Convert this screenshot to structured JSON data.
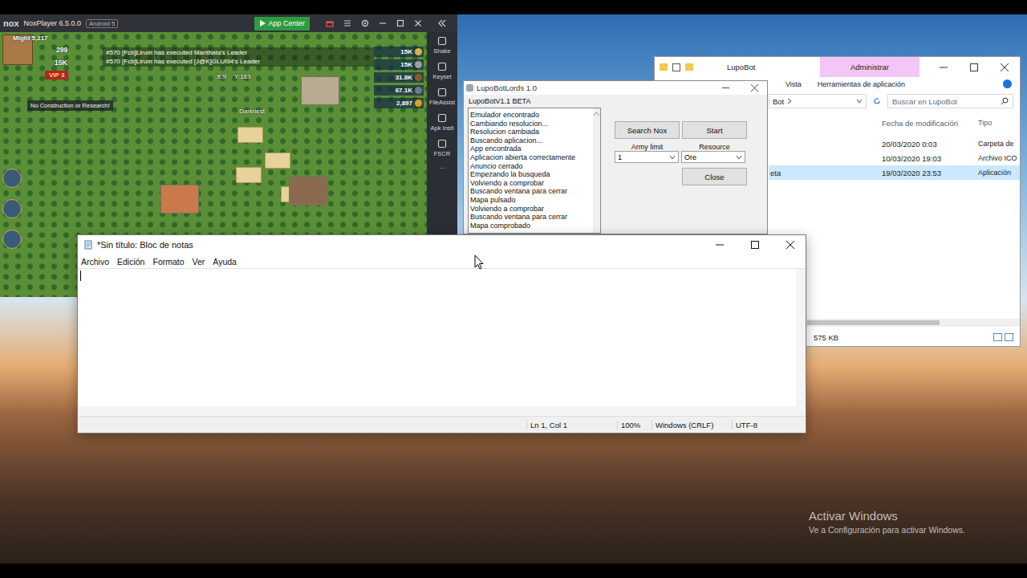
{
  "nox": {
    "logo": "nox",
    "title": "NoxPlayer 6.5.0.0",
    "android_badge": "Android 5",
    "app_center": "App Center",
    "toolbar": [
      {
        "label": "Shake",
        "kind": "button"
      },
      {
        "label": "Keyset",
        "kind": "button"
      },
      {
        "label": "FileAssist",
        "kind": "button"
      },
      {
        "label": "Apk Instl",
        "kind": "button"
      },
      {
        "label": "FSCR",
        "kind": "button"
      },
      {
        "label": "···",
        "kind": "more"
      }
    ]
  },
  "game": {
    "might": "Might 5,217",
    "gems": "299",
    "energy": "15K",
    "vip": "VIP 3",
    "chat": [
      "#570 [Fcb]Lirum has executed Manthata's Leader",
      "#570 [Fcb]Lirum has executed [J@K]GLUI94's Leader"
    ],
    "coords": {
      "x": "X:9",
      "y": "Y:183"
    },
    "notice": "No Construction or Research!",
    "resources": [
      {
        "value": "15K",
        "color": "#d9b24a"
      },
      {
        "value": "15K",
        "color": "#9aa0a6"
      },
      {
        "value": "31.8K",
        "color": "#8b5a2b"
      },
      {
        "value": "67.1K",
        "color": "#6c7a89"
      },
      {
        "value": "2,897",
        "color": "#e0a020"
      }
    ],
    "map_labels": [
      "Darknest"
    ]
  },
  "lupobot": {
    "title": "LupoBotLords 1.0",
    "version": "LupoBotV1.1 BETA",
    "log": [
      "Emulador encontrado",
      "Cambiando resolucion...",
      "Resolucion cambiada",
      "Buscando aplicacion...",
      "App encontrada",
      "Aplicacion abierta correctamente",
      "Anuncio cerrado",
      "Empezando la busqueda",
      "Volviendo a comprobar",
      "Buscando ventana para cerrar",
      "Mapa pulsado",
      "Volviendo a comprobar",
      "Buscando ventana para cerrar",
      "Mapa comprobado"
    ],
    "search_button": "Search Nox",
    "start_button": "Start",
    "close_button": "Close",
    "army_limit": {
      "label": "Army limit",
      "value": "1"
    },
    "resource": {
      "label": "Resource",
      "value": "Ore"
    }
  },
  "explorer": {
    "title": "LupoBot",
    "context_tab": "Administrar",
    "ribbon_tabs": [
      "Vista",
      "Herramientas de aplicación"
    ],
    "address": "Bot",
    "search_placeholder": "Buscar en LupoBot",
    "columns": [
      "Fecha de modificación",
      "Tipo"
    ],
    "rows": [
      {
        "name": "",
        "date": "20/03/2020 0:03",
        "type": "Carpeta de",
        "selected": false
      },
      {
        "name": "",
        "date": "10/03/2020 19:03",
        "type": "Archivo ICO",
        "selected": false
      },
      {
        "name": "eta",
        "date": "19/03/2020 23:53",
        "type": "Aplicación",
        "selected": true
      }
    ],
    "status": "575 KB"
  },
  "notepad": {
    "title": "*Sin título: Bloc de notas",
    "menu": [
      "Archivo",
      "Edición",
      "Formato",
      "Ver",
      "Ayuda"
    ],
    "text": "",
    "status": [
      "Ln 1, Col 1",
      "100%",
      "Windows (CRLF)",
      "UTF-8"
    ]
  },
  "watermark": {
    "title": "Activar Windows",
    "subtitle": "Ve a Configuración para activar Windows."
  }
}
